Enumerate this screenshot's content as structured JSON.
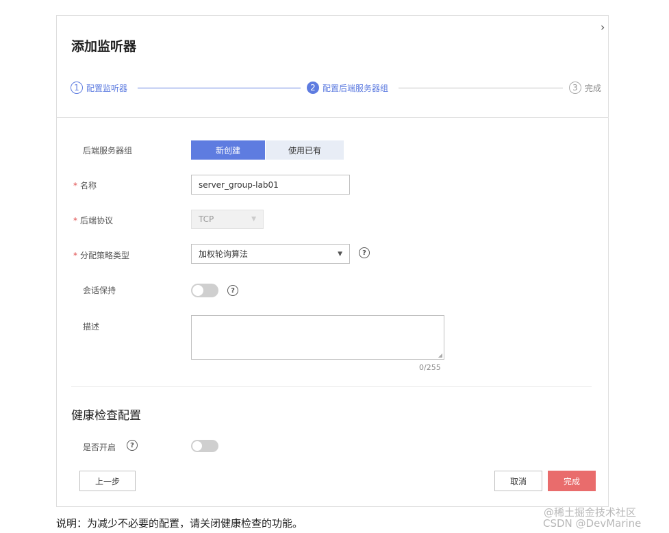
{
  "dialog": {
    "title": "添加监听器",
    "close_glyph": "›"
  },
  "steps": [
    {
      "num": "1",
      "label": "配置监听器",
      "state": "done"
    },
    {
      "num": "2",
      "label": "配置后端服务器组",
      "state": "active"
    },
    {
      "num": "3",
      "label": "完成",
      "state": "todo"
    }
  ],
  "form": {
    "backend_group": {
      "label": "后端服务器组",
      "options": [
        "新创建",
        "使用已有"
      ],
      "selected": "新创建"
    },
    "name": {
      "label": "名称",
      "value": "server_group-lab01",
      "required": true
    },
    "protocol": {
      "label": "后端协议",
      "value": "TCP",
      "required": true,
      "disabled": true
    },
    "strategy": {
      "label": "分配策略类型",
      "value": "加权轮询算法",
      "required": true
    },
    "session": {
      "label": "会话保持",
      "enabled": false
    },
    "description": {
      "label": "描述",
      "value": "",
      "counter": "0/255"
    }
  },
  "health": {
    "title": "健康检查配置",
    "enable_label": "是否开启",
    "enabled": false
  },
  "buttons": {
    "prev": "上一步",
    "cancel": "取消",
    "finish": "完成"
  },
  "required_mark": "*",
  "help_glyph": "?",
  "caret_glyph": "▼",
  "note": "说明：为减少不必要的配置，请关闭健康检查的功能。",
  "watermark": {
    "line1": "@稀土掘金技术社区",
    "line2": "CSDN @DevMarine"
  },
  "colors": {
    "accent": "#5e7ce0",
    "primary_button": "#e96c6c",
    "required": "#e05050"
  }
}
